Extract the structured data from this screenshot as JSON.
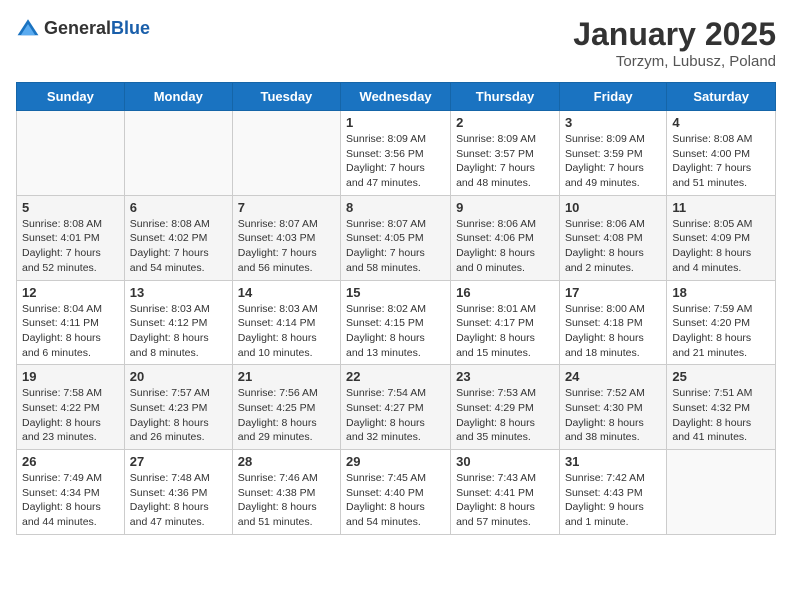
{
  "header": {
    "logo_general": "General",
    "logo_blue": "Blue",
    "month": "January 2025",
    "location": "Torzym, Lubusz, Poland"
  },
  "days_of_week": [
    "Sunday",
    "Monday",
    "Tuesday",
    "Wednesday",
    "Thursday",
    "Friday",
    "Saturday"
  ],
  "weeks": [
    [
      {
        "day": "",
        "info": ""
      },
      {
        "day": "",
        "info": ""
      },
      {
        "day": "",
        "info": ""
      },
      {
        "day": "1",
        "info": "Sunrise: 8:09 AM\nSunset: 3:56 PM\nDaylight: 7 hours and 47 minutes."
      },
      {
        "day": "2",
        "info": "Sunrise: 8:09 AM\nSunset: 3:57 PM\nDaylight: 7 hours and 48 minutes."
      },
      {
        "day": "3",
        "info": "Sunrise: 8:09 AM\nSunset: 3:59 PM\nDaylight: 7 hours and 49 minutes."
      },
      {
        "day": "4",
        "info": "Sunrise: 8:08 AM\nSunset: 4:00 PM\nDaylight: 7 hours and 51 minutes."
      }
    ],
    [
      {
        "day": "5",
        "info": "Sunrise: 8:08 AM\nSunset: 4:01 PM\nDaylight: 7 hours and 52 minutes."
      },
      {
        "day": "6",
        "info": "Sunrise: 8:08 AM\nSunset: 4:02 PM\nDaylight: 7 hours and 54 minutes."
      },
      {
        "day": "7",
        "info": "Sunrise: 8:07 AM\nSunset: 4:03 PM\nDaylight: 7 hours and 56 minutes."
      },
      {
        "day": "8",
        "info": "Sunrise: 8:07 AM\nSunset: 4:05 PM\nDaylight: 7 hours and 58 minutes."
      },
      {
        "day": "9",
        "info": "Sunrise: 8:06 AM\nSunset: 4:06 PM\nDaylight: 8 hours and 0 minutes."
      },
      {
        "day": "10",
        "info": "Sunrise: 8:06 AM\nSunset: 4:08 PM\nDaylight: 8 hours and 2 minutes."
      },
      {
        "day": "11",
        "info": "Sunrise: 8:05 AM\nSunset: 4:09 PM\nDaylight: 8 hours and 4 minutes."
      }
    ],
    [
      {
        "day": "12",
        "info": "Sunrise: 8:04 AM\nSunset: 4:11 PM\nDaylight: 8 hours and 6 minutes."
      },
      {
        "day": "13",
        "info": "Sunrise: 8:03 AM\nSunset: 4:12 PM\nDaylight: 8 hours and 8 minutes."
      },
      {
        "day": "14",
        "info": "Sunrise: 8:03 AM\nSunset: 4:14 PM\nDaylight: 8 hours and 10 minutes."
      },
      {
        "day": "15",
        "info": "Sunrise: 8:02 AM\nSunset: 4:15 PM\nDaylight: 8 hours and 13 minutes."
      },
      {
        "day": "16",
        "info": "Sunrise: 8:01 AM\nSunset: 4:17 PM\nDaylight: 8 hours and 15 minutes."
      },
      {
        "day": "17",
        "info": "Sunrise: 8:00 AM\nSunset: 4:18 PM\nDaylight: 8 hours and 18 minutes."
      },
      {
        "day": "18",
        "info": "Sunrise: 7:59 AM\nSunset: 4:20 PM\nDaylight: 8 hours and 21 minutes."
      }
    ],
    [
      {
        "day": "19",
        "info": "Sunrise: 7:58 AM\nSunset: 4:22 PM\nDaylight: 8 hours and 23 minutes."
      },
      {
        "day": "20",
        "info": "Sunrise: 7:57 AM\nSunset: 4:23 PM\nDaylight: 8 hours and 26 minutes."
      },
      {
        "day": "21",
        "info": "Sunrise: 7:56 AM\nSunset: 4:25 PM\nDaylight: 8 hours and 29 minutes."
      },
      {
        "day": "22",
        "info": "Sunrise: 7:54 AM\nSunset: 4:27 PM\nDaylight: 8 hours and 32 minutes."
      },
      {
        "day": "23",
        "info": "Sunrise: 7:53 AM\nSunset: 4:29 PM\nDaylight: 8 hours and 35 minutes."
      },
      {
        "day": "24",
        "info": "Sunrise: 7:52 AM\nSunset: 4:30 PM\nDaylight: 8 hours and 38 minutes."
      },
      {
        "day": "25",
        "info": "Sunrise: 7:51 AM\nSunset: 4:32 PM\nDaylight: 8 hours and 41 minutes."
      }
    ],
    [
      {
        "day": "26",
        "info": "Sunrise: 7:49 AM\nSunset: 4:34 PM\nDaylight: 8 hours and 44 minutes."
      },
      {
        "day": "27",
        "info": "Sunrise: 7:48 AM\nSunset: 4:36 PM\nDaylight: 8 hours and 47 minutes."
      },
      {
        "day": "28",
        "info": "Sunrise: 7:46 AM\nSunset: 4:38 PM\nDaylight: 8 hours and 51 minutes."
      },
      {
        "day": "29",
        "info": "Sunrise: 7:45 AM\nSunset: 4:40 PM\nDaylight: 8 hours and 54 minutes."
      },
      {
        "day": "30",
        "info": "Sunrise: 7:43 AM\nSunset: 4:41 PM\nDaylight: 8 hours and 57 minutes."
      },
      {
        "day": "31",
        "info": "Sunrise: 7:42 AM\nSunset: 4:43 PM\nDaylight: 9 hours and 1 minute."
      },
      {
        "day": "",
        "info": ""
      }
    ]
  ]
}
